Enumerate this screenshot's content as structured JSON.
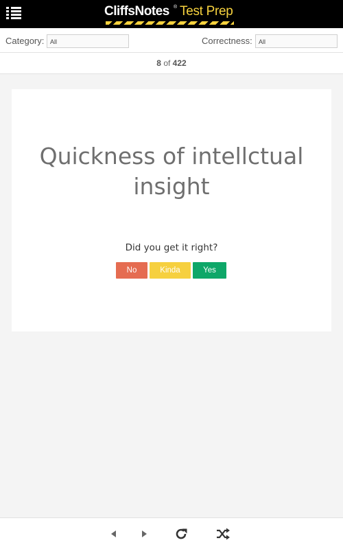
{
  "header": {
    "menu_icon": "hamburger-list-icon",
    "logo_brand": "CliffsNotes",
    "logo_reg": "®",
    "logo_sub": "Test Prep",
    "brand_color": "#f7d23e"
  },
  "filters": {
    "category_label": "Category:",
    "category_value": "All",
    "correctness_label": "Correctness:",
    "correctness_value": "All"
  },
  "counter": {
    "current": "8",
    "of": "of",
    "total": "422"
  },
  "card": {
    "text": "Quickness of intellctual insight",
    "question": "Did you get it right?",
    "buttons": {
      "no": "No",
      "kinda": "Kinda",
      "yes": "Yes"
    },
    "colors": {
      "no": "#e56c51",
      "kinda": "#f6d03f",
      "yes": "#0ea768"
    }
  },
  "toolbar": {
    "icons": [
      "previous-icon",
      "next-icon",
      "reload-icon",
      "shuffle-icon"
    ]
  }
}
